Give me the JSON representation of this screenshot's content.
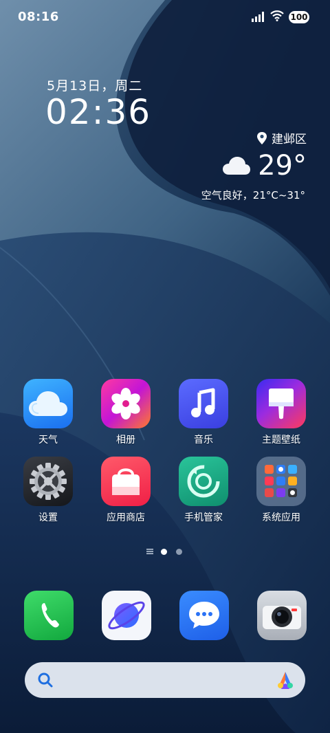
{
  "status_bar": {
    "time": "08:16",
    "battery": "100",
    "signal_icon": "signal-bars-icon",
    "wifi_icon": "wifi-icon"
  },
  "clock_widget": {
    "date": "5月13日，周二",
    "time": "02:36"
  },
  "weather_widget": {
    "location": "建邺区",
    "temperature": "29°",
    "detail": "空气良好，21°C~31°",
    "condition_icon": "cloud-icon"
  },
  "apps": [
    {
      "label": "天气",
      "icon": "weather-app-icon"
    },
    {
      "label": "相册",
      "icon": "gallery-app-icon"
    },
    {
      "label": "音乐",
      "icon": "music-app-icon"
    },
    {
      "label": "主题壁纸",
      "icon": "themes-app-icon"
    },
    {
      "label": "设置",
      "icon": "settings-app-icon"
    },
    {
      "label": "应用商店",
      "icon": "app-store-icon"
    },
    {
      "label": "手机管家",
      "icon": "phone-manager-icon"
    },
    {
      "label": "系统应用",
      "icon": "system-apps-folder-icon"
    }
  ],
  "page_indicator": {
    "pages": 2,
    "current_page": 1
  },
  "dock": [
    {
      "icon": "phone-app-icon"
    },
    {
      "icon": "browser-app-icon"
    },
    {
      "icon": "messages-app-icon"
    },
    {
      "icon": "camera-app-icon"
    }
  ],
  "search_bar": {
    "search_icon": "search-icon",
    "assistant_icon": "ai-assistant-icon"
  },
  "colors": {
    "accent": "#2b8ff5",
    "search_bg": "#dbe2ec",
    "active_dot": "#ffffff",
    "inactive_dot": "#8d9bb0"
  }
}
